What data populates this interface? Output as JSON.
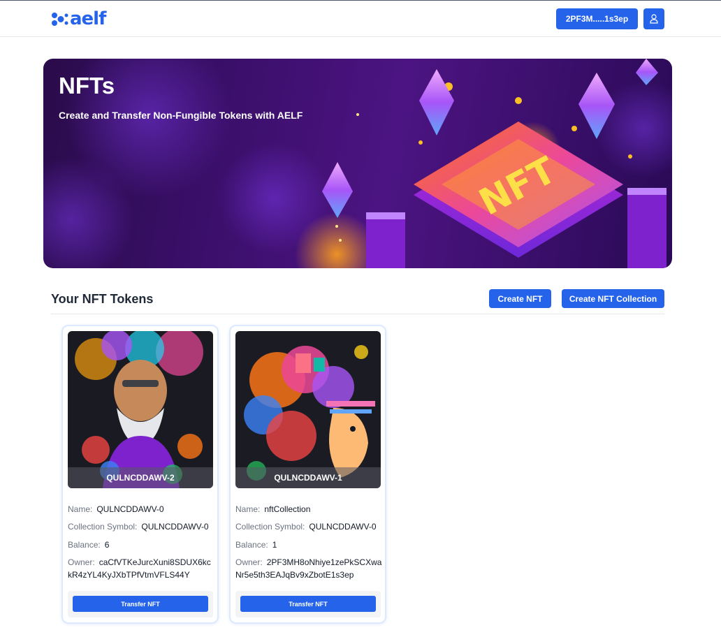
{
  "header": {
    "logo_text": "aelf",
    "wallet_label": "2PF3M.....1s3ep",
    "user_icon": "user-icon",
    "colors": {
      "primary": "#2563eb"
    }
  },
  "banner": {
    "title": "NFTs",
    "subtitle": "Create and Transfer Non-Fungible Tokens with AELF",
    "art_text": "NFT"
  },
  "section": {
    "title": "Your NFT Tokens",
    "create_nft_label": "Create NFT",
    "create_collection_label": "Create NFT Collection"
  },
  "labels": {
    "name": "Name:",
    "collection_symbol": "Collection Symbol:",
    "balance": "Balance:",
    "owner": "Owner:"
  },
  "cards": [
    {
      "symbol": "QULNCDDAWV-2",
      "name": "QULNCDDAWV-0",
      "collection_symbol": "QULNCDDAWV-0",
      "balance": "6",
      "owner": "caCfVTKeJurcXuni8SDUX6kckR4zYL4KyJXbTPfVtmVFLS44Y",
      "button_label": "Transfer NFT"
    },
    {
      "symbol": "QULNCDDAWV-1",
      "name": "nftCollection",
      "collection_symbol": "QULNCDDAWV-0",
      "balance": "1",
      "owner": "2PF3MH8oNhiye1zePkSCXwaNr5e5th3EAJqBv9xZbotE1s3ep",
      "button_label": "Transfer NFT"
    }
  ]
}
